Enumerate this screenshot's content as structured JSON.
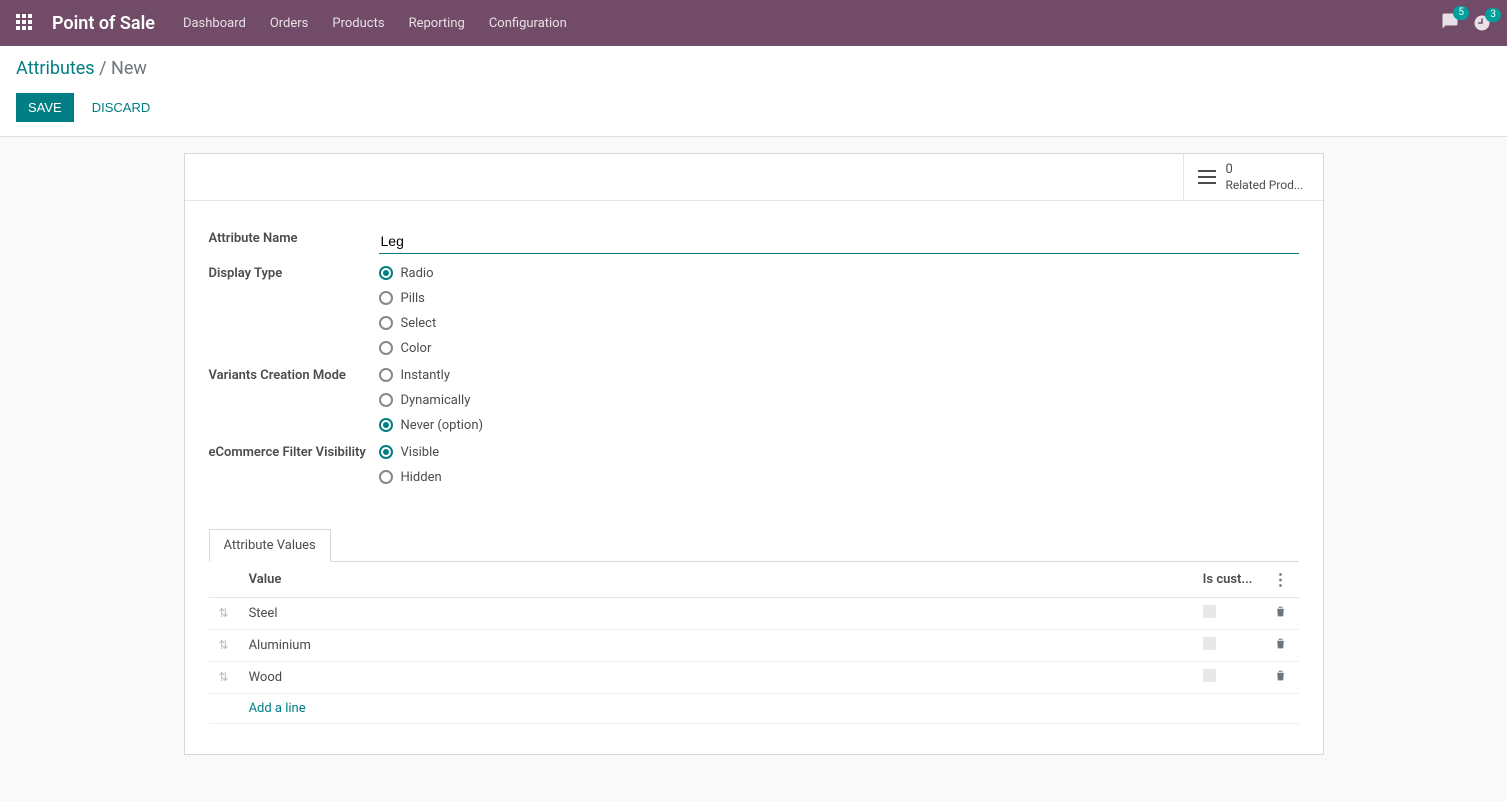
{
  "topnav": {
    "brand": "Point of Sale",
    "items": [
      "Dashboard",
      "Orders",
      "Products",
      "Reporting",
      "Configuration"
    ],
    "msg_badge": "5",
    "clock_badge": "3"
  },
  "breadcrumb": {
    "parent": "Attributes",
    "sep": "/",
    "current": "New"
  },
  "buttons": {
    "save": "SAVE",
    "discard": "DISCARD"
  },
  "stat": {
    "count": "0",
    "label": "Related Prod..."
  },
  "form": {
    "attribute_name_label": "Attribute Name",
    "attribute_name_value": "Leg",
    "display_type_label": "Display Type",
    "display_type_options": [
      "Radio",
      "Pills",
      "Select",
      "Color"
    ],
    "display_type_selected": 0,
    "variants_label": "Variants Creation Mode",
    "variants_options": [
      "Instantly",
      "Dynamically",
      "Never (option)"
    ],
    "variants_selected": 2,
    "ecom_label": "eCommerce Filter Visibility",
    "ecom_options": [
      "Visible",
      "Hidden"
    ],
    "ecom_selected": 0
  },
  "tab": {
    "attribute_values": "Attribute Values"
  },
  "table": {
    "col_value": "Value",
    "col_custom": "Is cust...",
    "rows": [
      "Steel",
      "Aluminium",
      "Wood"
    ],
    "add_line": "Add a line"
  }
}
